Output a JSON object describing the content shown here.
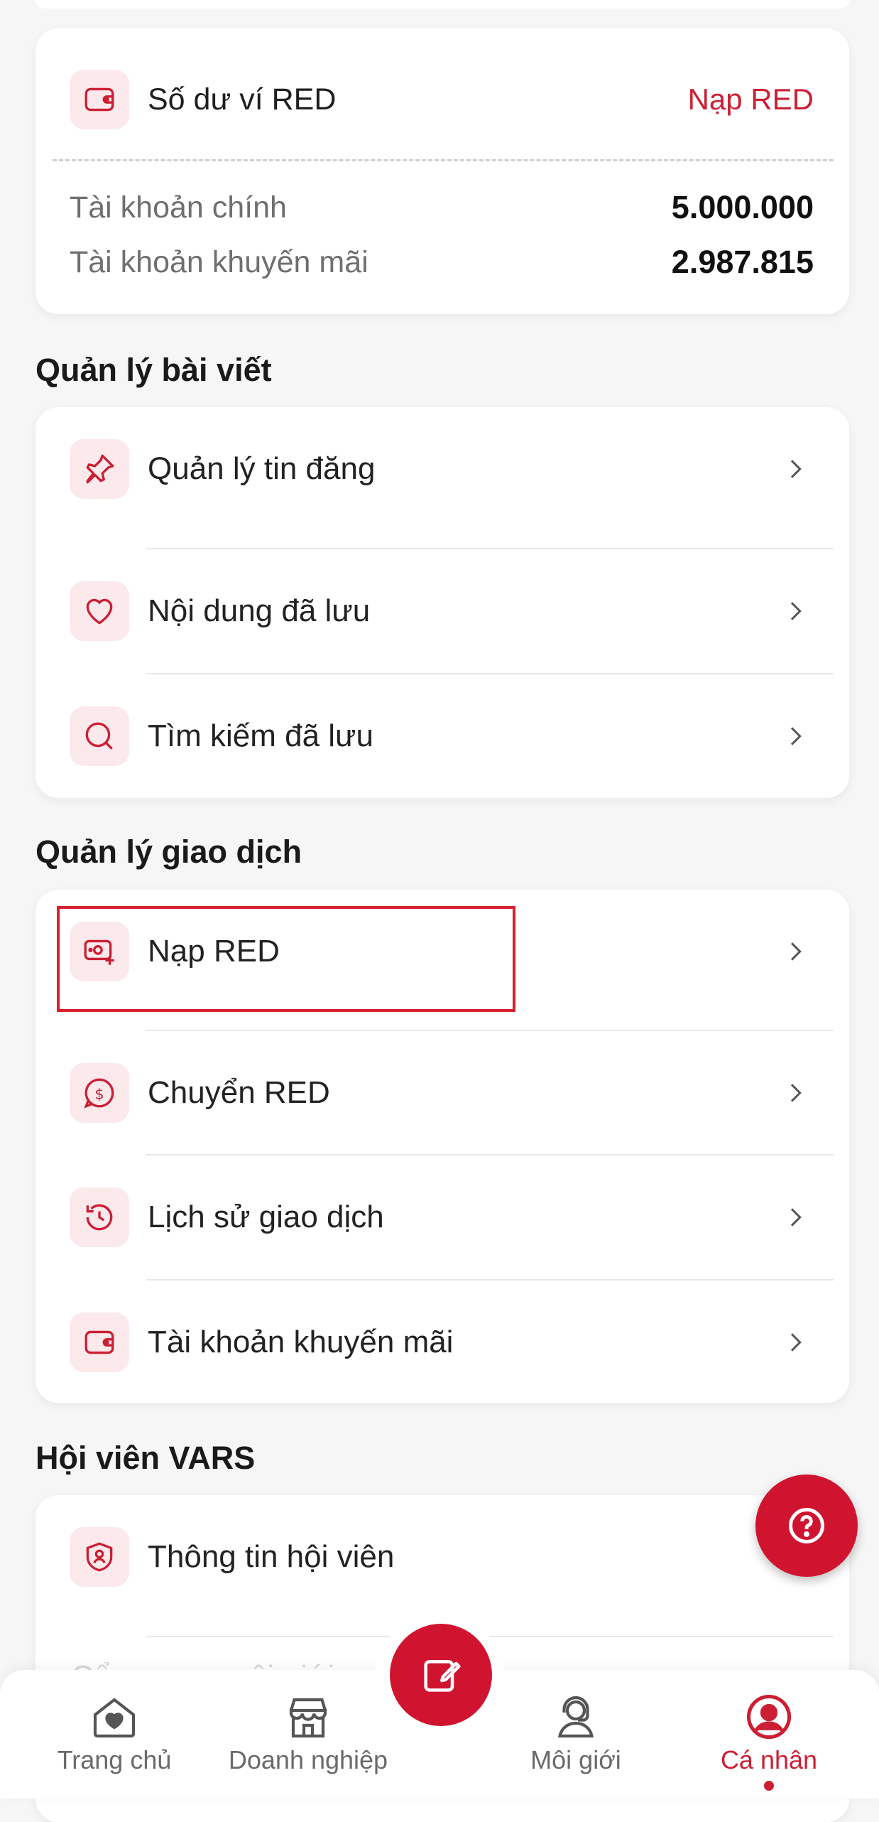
{
  "wallet": {
    "title": "Số dư ví RED",
    "topup_link": "Nạp RED",
    "main_account_label": "Tài khoản chính",
    "main_account_value": "5.000.000",
    "promo_account_label": "Tài khoản khuyến mãi",
    "promo_account_value": "2.987.815"
  },
  "posts": {
    "title": "Quản lý bài viết",
    "items": [
      {
        "label": "Quản lý tin đăng",
        "icon": "pin-icon"
      },
      {
        "label": "Nội dung đã lưu",
        "icon": "heart-icon"
      },
      {
        "label": "Tìm kiếm đã lưu",
        "icon": "search-icon"
      }
    ]
  },
  "transactions": {
    "title": "Quản lý giao dịch",
    "items": [
      {
        "label": "Nạp RED",
        "icon": "money-add-icon"
      },
      {
        "label": "Chuyển RED",
        "icon": "dollar-transfer-icon"
      },
      {
        "label": "Lịch sử giao dịch",
        "icon": "history-icon"
      },
      {
        "label": "Tài khoản khuyến mãi",
        "icon": "wallet-icon"
      }
    ]
  },
  "membership": {
    "title": "Hội viên VARS",
    "items": [
      {
        "label": "Thông tin hội viên",
        "icon": "member-shield-icon"
      },
      {
        "label": "Cẩm nang môi giới",
        "icon": "book-icon"
      }
    ]
  },
  "bottom_nav": {
    "tabs": [
      {
        "label": "Trang chủ",
        "icon": "home-heart-icon"
      },
      {
        "label": "Doanh nghiệp",
        "icon": "store-icon"
      },
      {
        "label": "Môi giới",
        "icon": "agent-headset-icon"
      },
      {
        "label": "Cá nhân",
        "icon": "profile-icon",
        "active": true
      }
    ],
    "center_icon": "compose-icon"
  },
  "colors": {
    "accent": "#cc1f34",
    "icon_bg": "#fbe9ec",
    "background": "#f6f6f6"
  }
}
